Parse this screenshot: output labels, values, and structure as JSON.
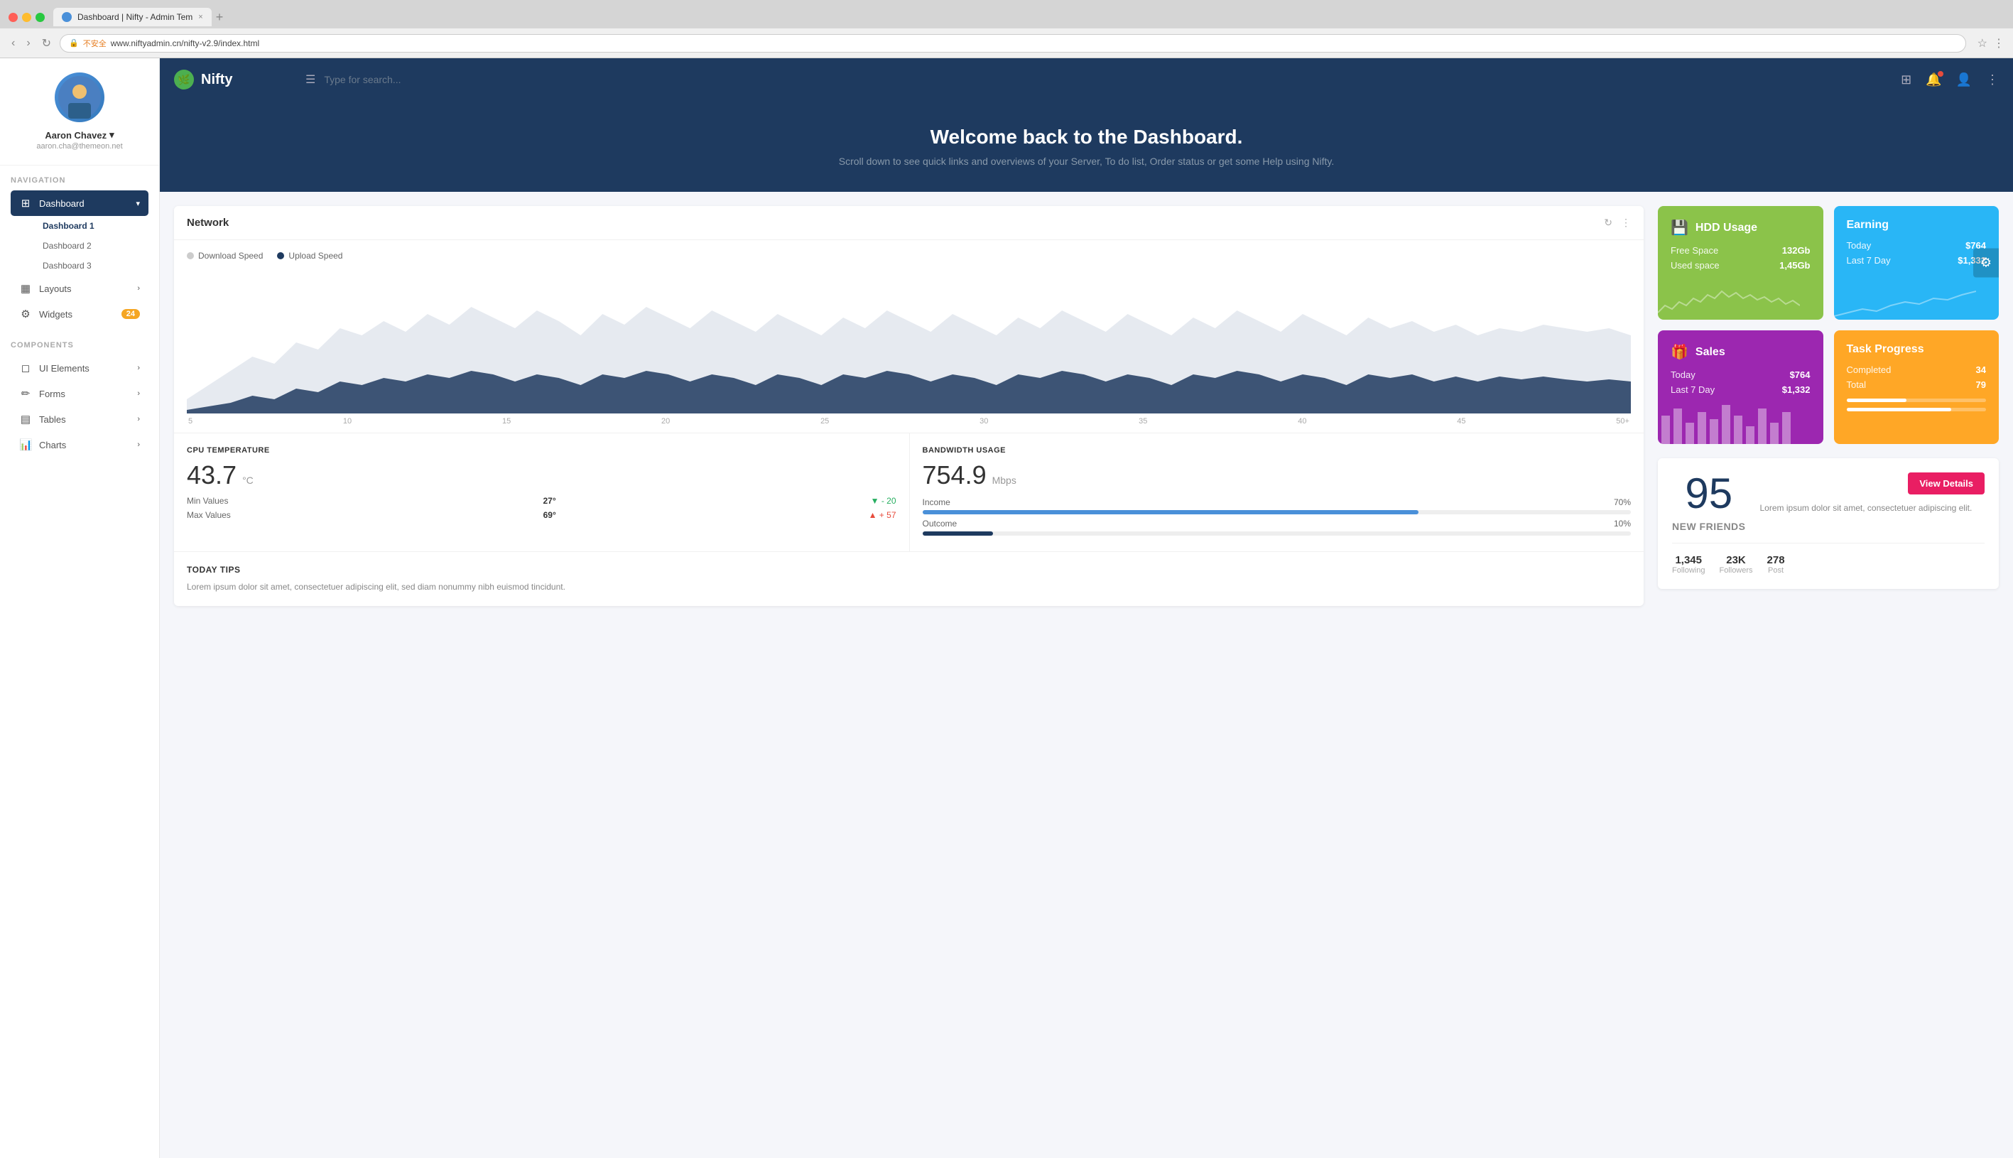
{
  "browser": {
    "tab_title": "Dashboard | Nifty - Admin Tem",
    "url": "www.niftyadmin.cn/nifty-v2.9/index.html",
    "protocol": "不安全",
    "close_label": "×",
    "new_tab_label": "+"
  },
  "header": {
    "logo_text": "Nifty",
    "search_placeholder": "Type for search...",
    "hamburger_icon": "☰"
  },
  "sidebar": {
    "user": {
      "name": "Aaron Chavez",
      "email": "aaron.cha@themeon.net"
    },
    "nav_section_label": "NAVIGATION",
    "nav_items": [
      {
        "id": "dashboard",
        "label": "Dashboard",
        "icon": "⊞",
        "active": true,
        "has_sub": true
      },
      {
        "id": "layouts",
        "label": "Layouts",
        "icon": "▦",
        "has_chevron": true
      },
      {
        "id": "widgets",
        "label": "Widgets",
        "icon": "⚙",
        "badge": "24"
      }
    ],
    "dashboard_sub": [
      {
        "id": "dashboard1",
        "label": "Dashboard 1",
        "active": true
      },
      {
        "id": "dashboard2",
        "label": "Dashboard 2"
      },
      {
        "id": "dashboard3",
        "label": "Dashboard 3"
      }
    ],
    "components_section_label": "COMPONENTS",
    "component_items": [
      {
        "id": "ui-elements",
        "label": "UI Elements",
        "icon": "◻",
        "has_chevron": true
      },
      {
        "id": "forms",
        "label": "Forms",
        "icon": "✏",
        "has_chevron": true
      },
      {
        "id": "tables",
        "label": "Tables",
        "icon": "▤",
        "has_chevron": true
      },
      {
        "id": "charts",
        "label": "Charts",
        "icon": "📊",
        "has_chevron": true
      }
    ]
  },
  "hero": {
    "title": "Welcome back to the Dashboard.",
    "subtitle": "Scroll down to see quick links and overviews of your Server, To do list, Order status or get some Help using Nifty."
  },
  "network_card": {
    "title": "Network",
    "legend_download": "Download Speed",
    "legend_upload": "Upload Speed",
    "x_labels": [
      "5",
      "10",
      "15",
      "20",
      "25",
      "30",
      "35",
      "40",
      "45",
      "50+"
    ]
  },
  "cpu": {
    "label": "CPU TEMPERATURE",
    "value": "43.7",
    "unit": "°C",
    "min_label": "Min Values",
    "min_value": "27°",
    "min_trend": "▼ - 20",
    "max_label": "Max Values",
    "max_value": "69°",
    "max_trend": "▲ + 57"
  },
  "bandwidth": {
    "label": "BANDWIDTH USAGE",
    "value": "754.9",
    "unit": "Mbps",
    "income_label": "Income",
    "income_pct": "70%",
    "outcome_label": "Outcome",
    "outcome_pct": "10%"
  },
  "tips": {
    "title": "TODAY TIPS",
    "text": "Lorem ipsum dolor sit amet, consectetuer adipiscing elit, sed diam nonummy nibh euismod tincidunt."
  },
  "hdd_widget": {
    "title": "HDD Usage",
    "icon": "💾",
    "free_label": "Free Space",
    "free_value": "132Gb",
    "used_label": "Used space",
    "used_value": "1,45Gb"
  },
  "earning_widget": {
    "title": "Earning",
    "today_label": "Today",
    "today_value": "$764",
    "last7_label": "Last 7 Day",
    "last7_value": "$1,332"
  },
  "sales_widget": {
    "title": "Sales",
    "icon": "🎁",
    "today_label": "Today",
    "today_value": "$764",
    "last7_label": "Last 7 Day",
    "last7_value": "$1,332"
  },
  "task_widget": {
    "title": "Task Progress",
    "completed_label": "Completed",
    "completed_value": "34",
    "total_label": "Total",
    "total_value": "79"
  },
  "friends": {
    "count": "95",
    "label": "NEW FRIENDS",
    "description": "Lorem ipsum dolor sit amet, consectetuer adipiscing elit.",
    "view_details_label": "View Details",
    "stats": [
      {
        "value": "1,345",
        "key": "Following"
      },
      {
        "value": "23K",
        "key": "Followers"
      },
      {
        "value": "278",
        "key": "Post"
      }
    ]
  }
}
